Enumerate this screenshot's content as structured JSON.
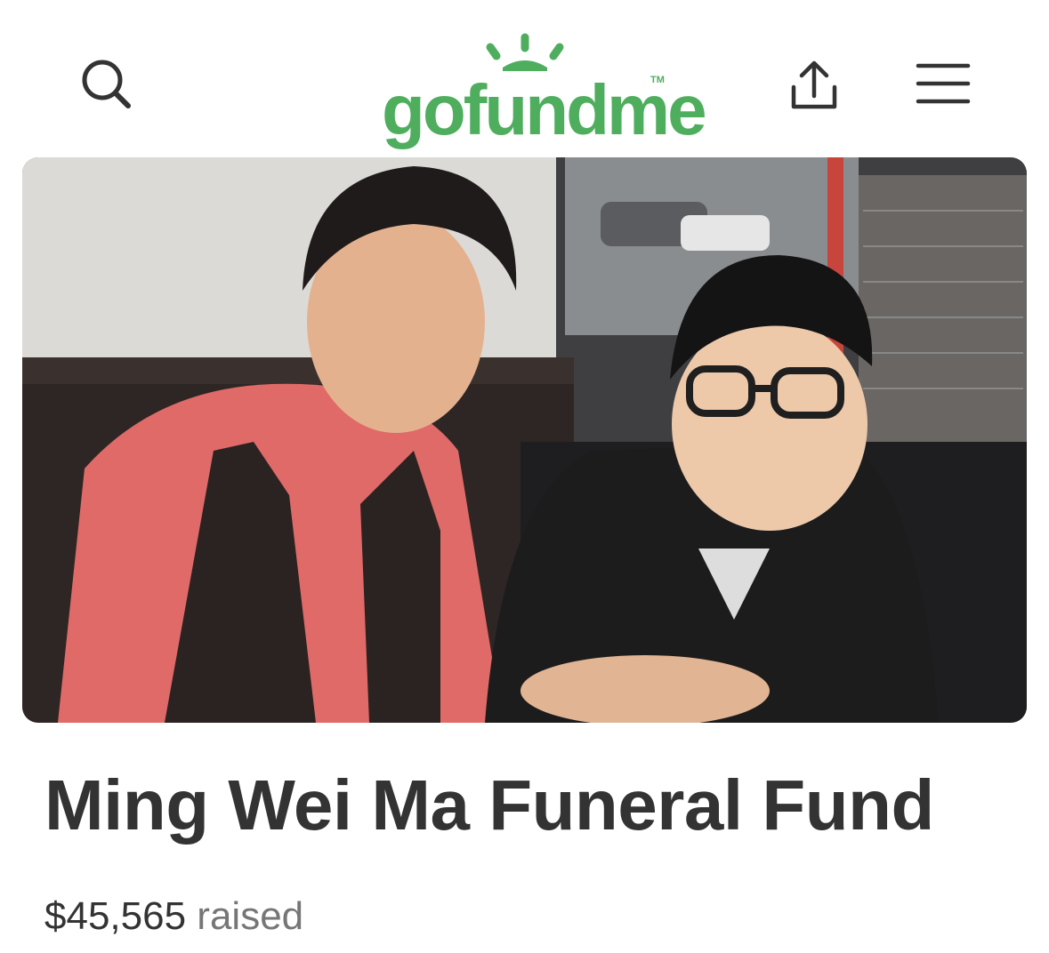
{
  "header": {
    "logo_text": "gofundme",
    "logo_tm": "TM",
    "icons": {
      "search": "search-icon",
      "share": "share-icon",
      "menu": "hamburger-menu-icon"
    }
  },
  "campaign": {
    "title": "Ming Wei Ma Funeral Fund",
    "amount_raised": "$45,565",
    "raised_label": "raised"
  },
  "colors": {
    "brand": "#4eae5e",
    "text": "#333333",
    "muted": "#767676"
  }
}
